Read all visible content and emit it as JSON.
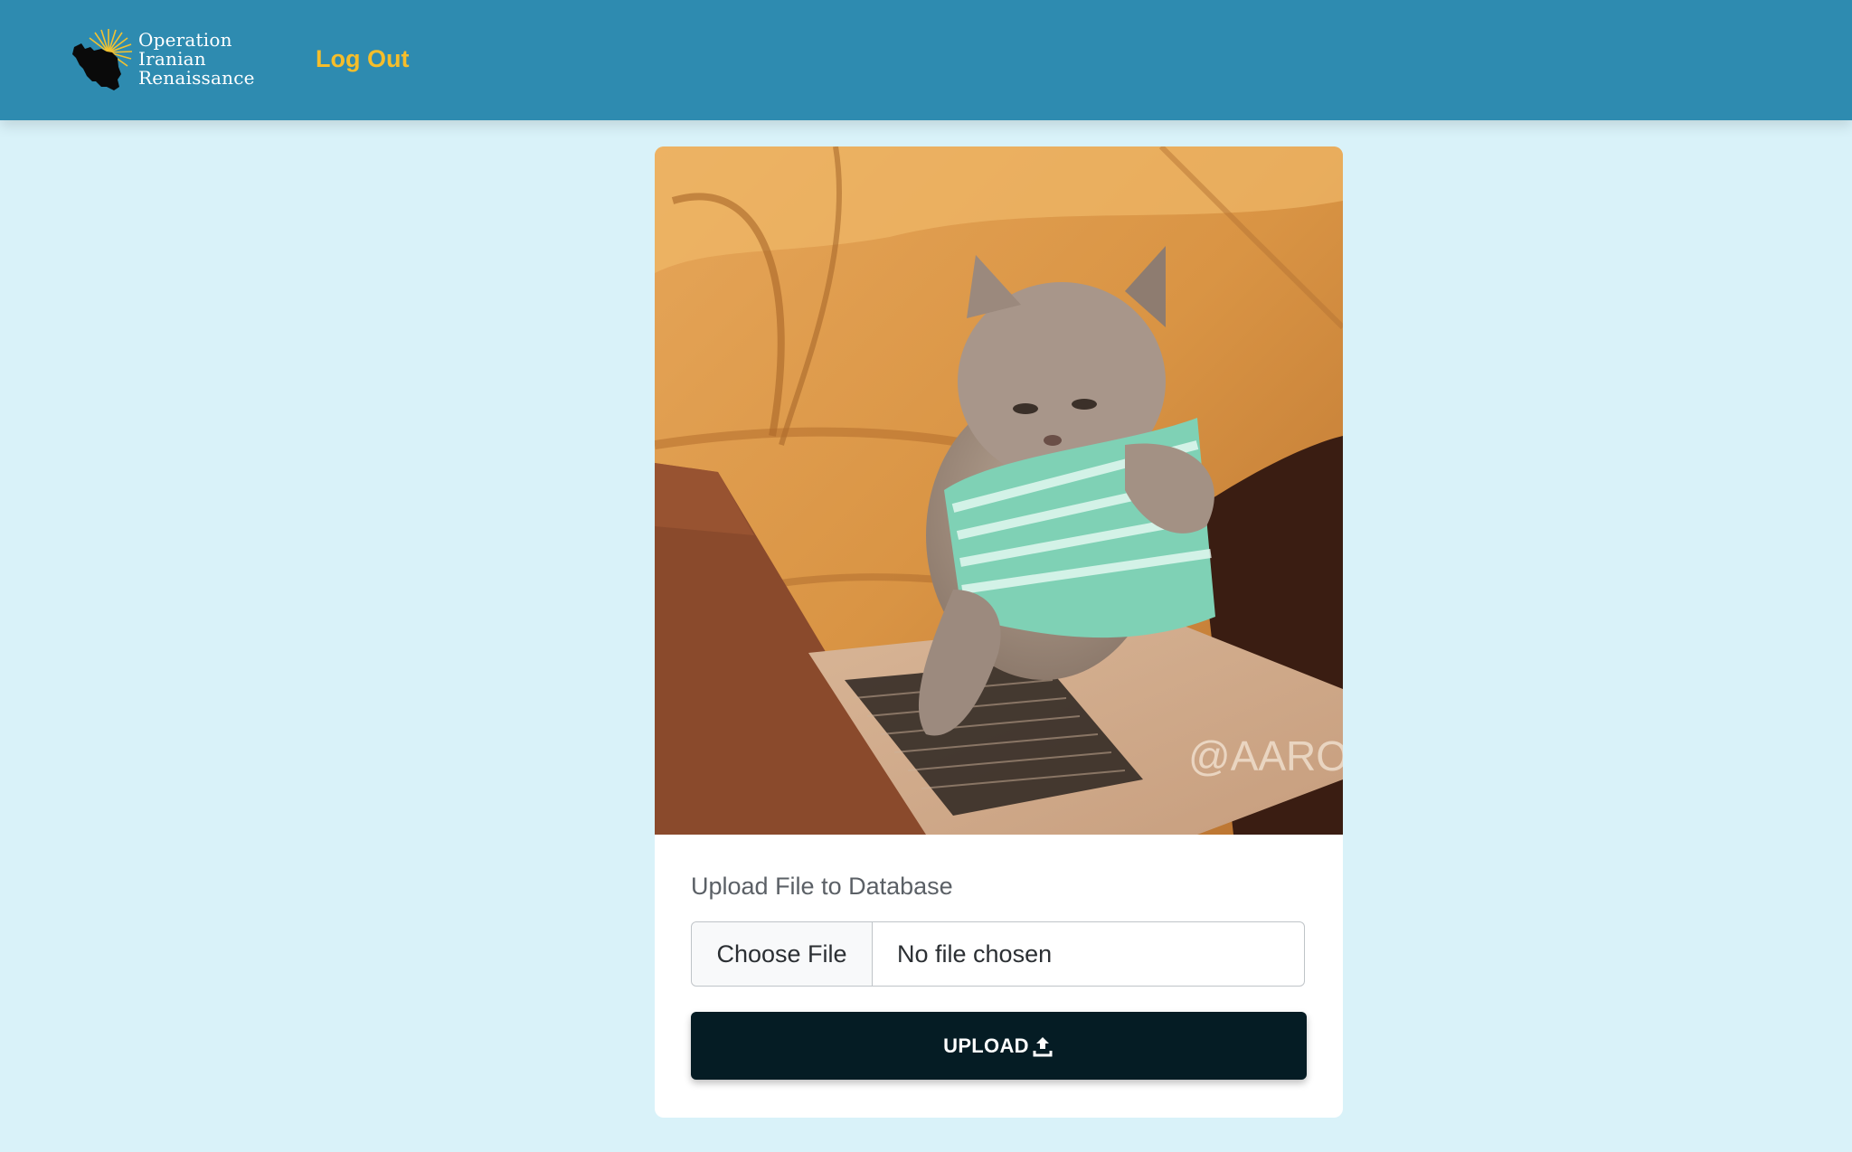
{
  "header": {
    "brand": {
      "line1": "Operation",
      "line2": "Iranian",
      "line3": "Renaissance"
    },
    "logout_label": "Log Out"
  },
  "card": {
    "image_alt": "Cat typing on a laptop",
    "watermark": "@AARON",
    "upload_label": "Upload File to Database",
    "choose_file_label": "Choose File",
    "file_status": "No file chosen",
    "upload_button_label": "UPLOAD",
    "upload_icon": "upload-icon"
  },
  "colors": {
    "navbar": "#2e8bb0",
    "page_background": "#d9f2f9",
    "logout_accent": "#f6be2a",
    "upload_button": "#051c24"
  }
}
